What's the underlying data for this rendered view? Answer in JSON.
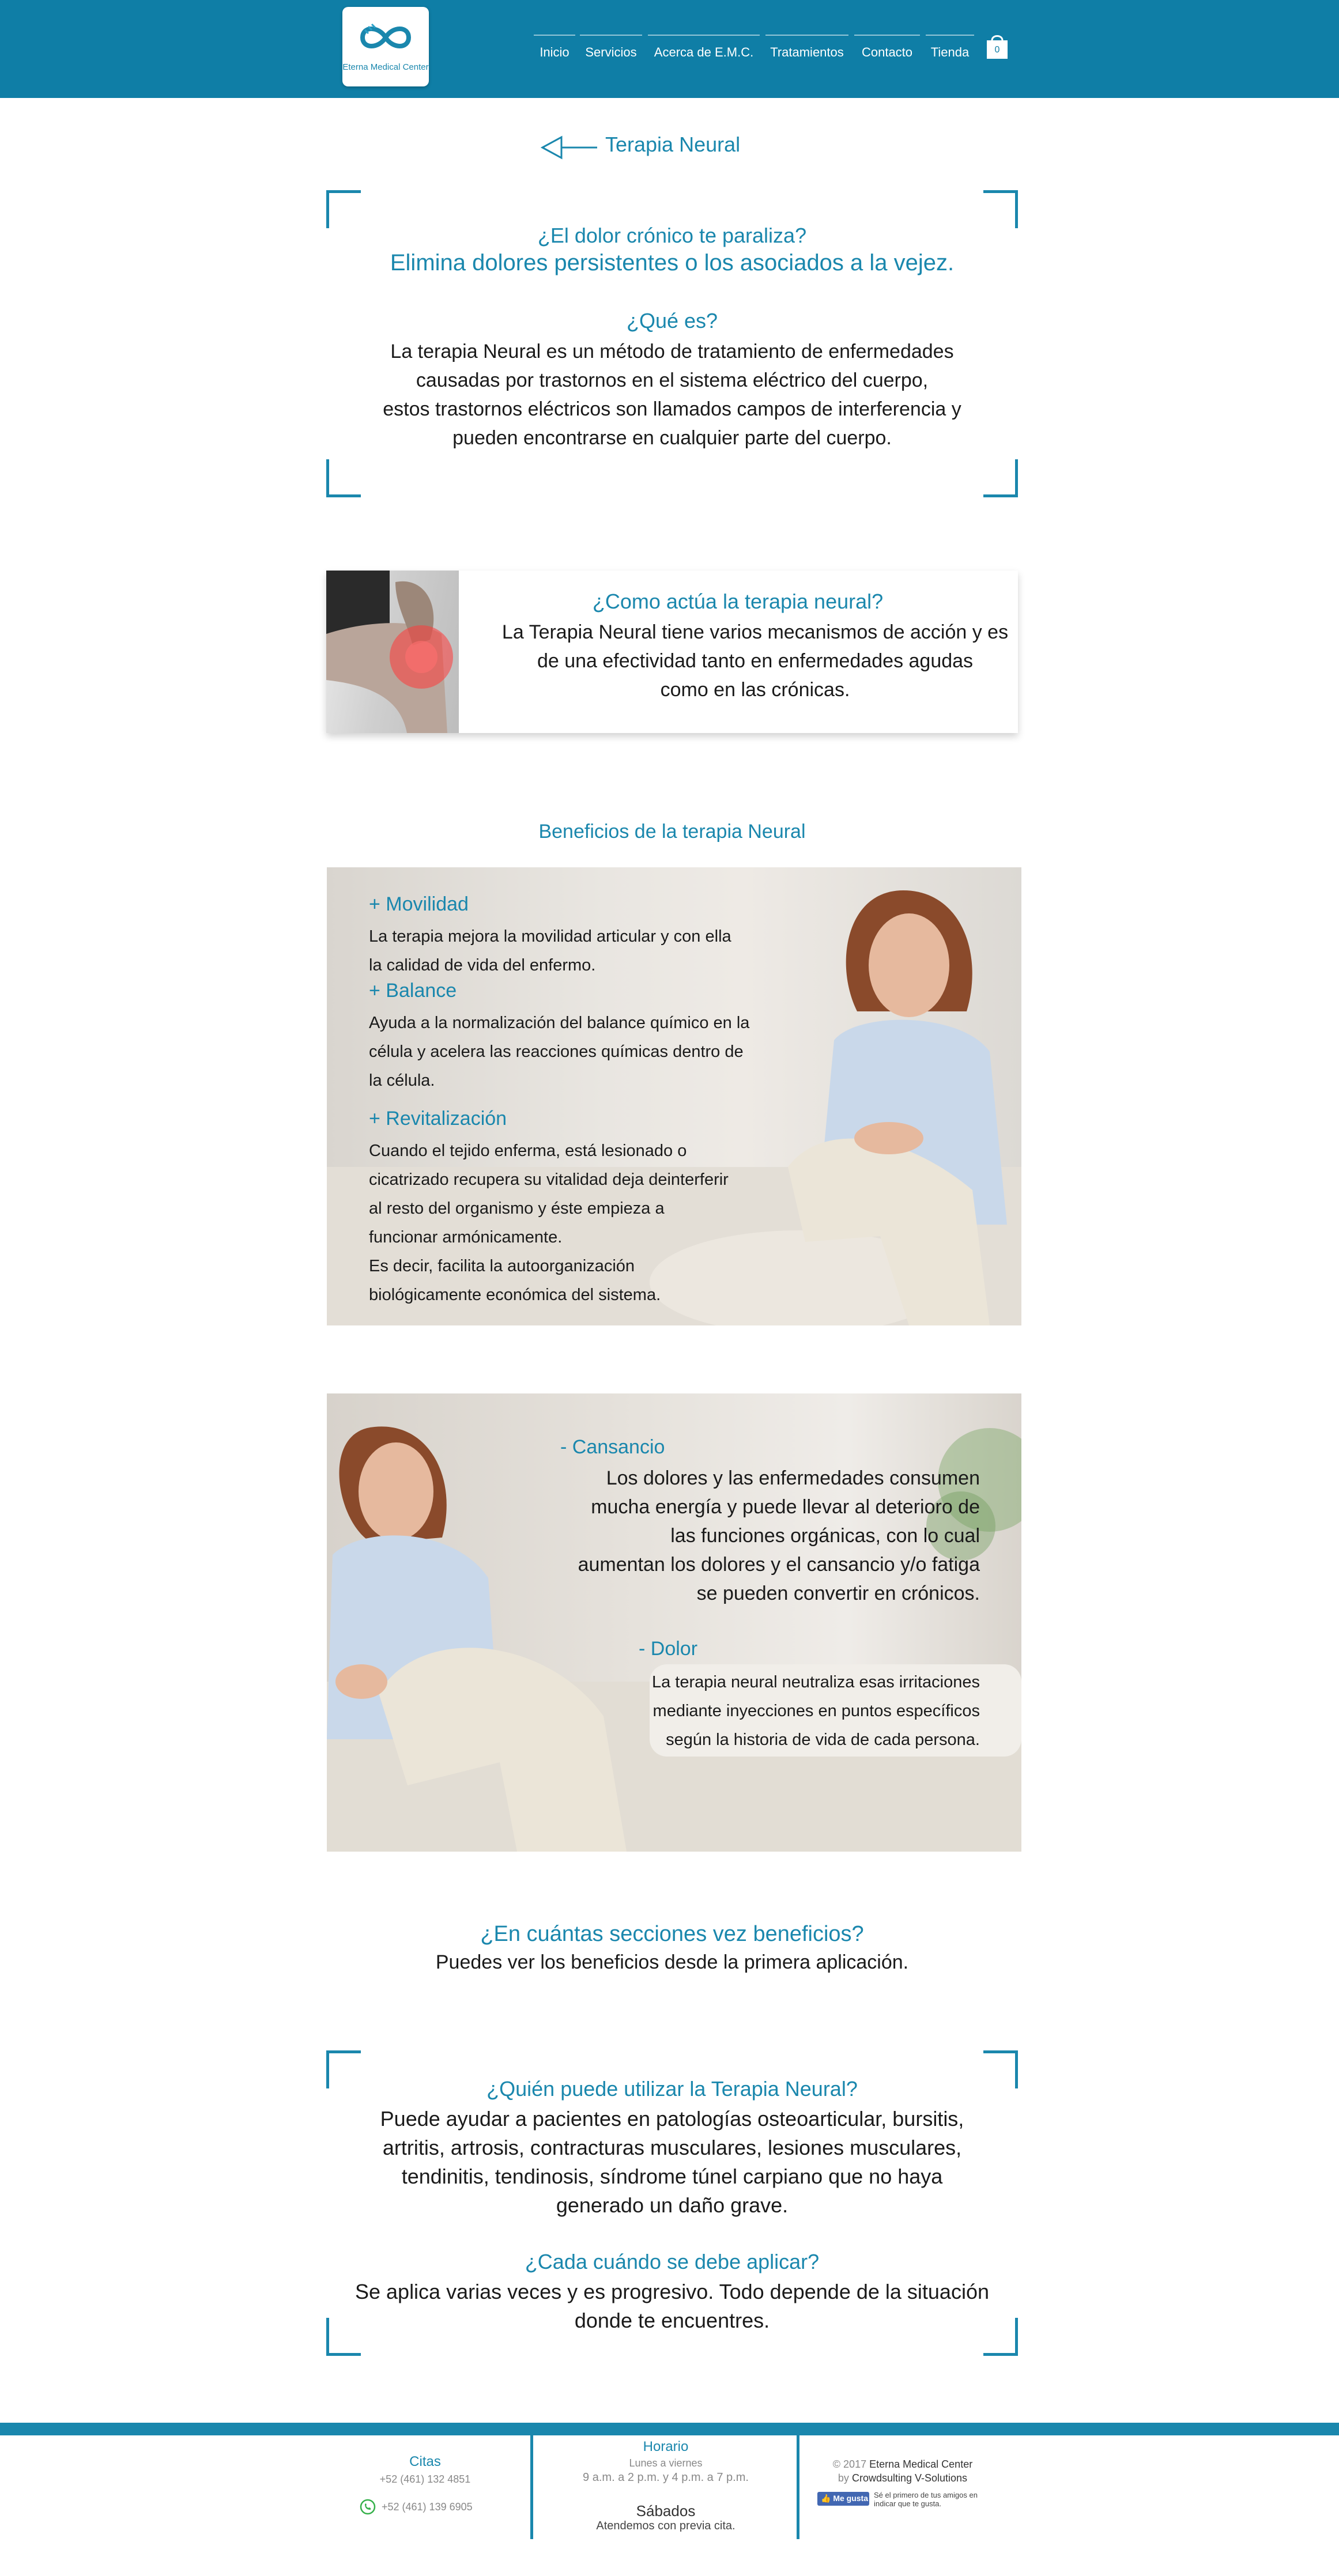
{
  "header": {
    "logo_text": "Eterna Medical Center",
    "nav": [
      "Inicio",
      "Servicios",
      "Acerca de E.M.C.",
      "Tratamientos",
      "Contacto",
      "Tienda"
    ],
    "cart_count": "0"
  },
  "page_title": "Terapia Neural",
  "intro": {
    "question": "¿El dolor crónico te paraliza?",
    "subtitle": "Elimina dolores persistentes o los asociados a la vejez.",
    "what_title": "¿Qué es?",
    "what_lines": [
      "La terapia Neural es un método de tratamiento de enfermedades",
      "causadas por trastornos en el sistema eléctrico del cuerpo,",
      "estos trastornos eléctricos son llamados campos de interferencia y",
      "pueden encontrarse en cualquier parte del cuerpo."
    ]
  },
  "how": {
    "title": "¿Como actúa la terapia neural?",
    "lines": [
      "La Terapia Neural tiene varios mecanismos de acción y es",
      "de una efectividad tanto en enfermedades agudas",
      "como en las crónicas."
    ]
  },
  "benefits_heading": "Beneficios de la terapia Neural",
  "benefits": [
    {
      "title": "+ Movilidad",
      "lines": [
        "La terapia mejora la movilidad articular y con ella",
        "la calidad de vida del enfermo."
      ]
    },
    {
      "title": "+ Balance",
      "lines": [
        "Ayuda a la normalización del balance químico en la",
        "célula y acelera las reacciones químicas dentro de",
        "la célula."
      ]
    },
    {
      "title": "+ Revitalización",
      "lines": [
        "Cuando el tejido enferma, está lesionado o",
        "cicatrizado recupera su vitalidad deja deinterferir",
        "al resto del organismo y éste empieza a",
        "funcionar armónicamente.",
        "Es decir, facilita la autoorganización",
        "biológicamente económica del sistema."
      ]
    }
  ],
  "benefits2": [
    {
      "title": "-  Cansancio",
      "lines": [
        "Los dolores y las enfermedades consumen",
        "mucha energía y puede llevar al deterioro de",
        "las funciones orgánicas, con lo cual",
        "aumentan los dolores y el cansancio y/o fatiga",
        "se pueden convertir en crónicos."
      ]
    },
    {
      "title": "-  Dolor",
      "lines": [
        "La terapia neural neutraliza esas irritaciones",
        "mediante inyecciones en puntos específicos",
        "según la historia de vida de cada persona."
      ]
    }
  ],
  "sessions": {
    "title": "¿En cuántas secciones vez beneficios?",
    "text": "Puedes ver los beneficios desde la primera aplicación."
  },
  "who": {
    "title": "¿Quién puede utilizar la Terapia Neural?",
    "lines": [
      "Puede ayudar a pacientes en patologías osteoarticular, bursitis,",
      "artritis, artrosis, contracturas musculares, lesiones musculares,",
      "tendinitis, tendinosis, síndrome túnel carpiano que no haya",
      "generado un daño grave."
    ]
  },
  "frequency": {
    "title": "¿Cada cuándo se debe aplicar?",
    "lines": [
      "Se aplica varias veces y es progresivo. Todo depende de la situación",
      "donde te encuentres."
    ]
  },
  "footer": {
    "citas_title": "Citas",
    "phone1": "+52 (461) 132 4851",
    "phone2": "+52 (461) 139 6905",
    "horario_title": "Horario",
    "weekdays": "Lunes a viernes",
    "weekday_hours": "9 a.m. a 2 p.m. y 4 p.m. a 7 p.m.",
    "saturday": "Sábados",
    "saturday_hours": "Atendemos con previa cita.",
    "copyright_prefix": "© 2017",
    "copyright_name": "Eterna Medical Center",
    "by_prefix": "by",
    "by_name": "Crowdsulting V-Solutions",
    "like_button": "Me gusta",
    "like_text_1": "Sé el primero de tus amigos en",
    "like_text_2": "indicar que te gusta."
  },
  "colors": {
    "header_bg": "#0f7ea6",
    "accent": "#1a87ad",
    "footer_bar": "#1a87ad"
  },
  "icons": [
    "infinity-logo-icon",
    "cart-icon",
    "back-arrow-icon",
    "whatsapp-icon",
    "facebook-like-icon"
  ]
}
